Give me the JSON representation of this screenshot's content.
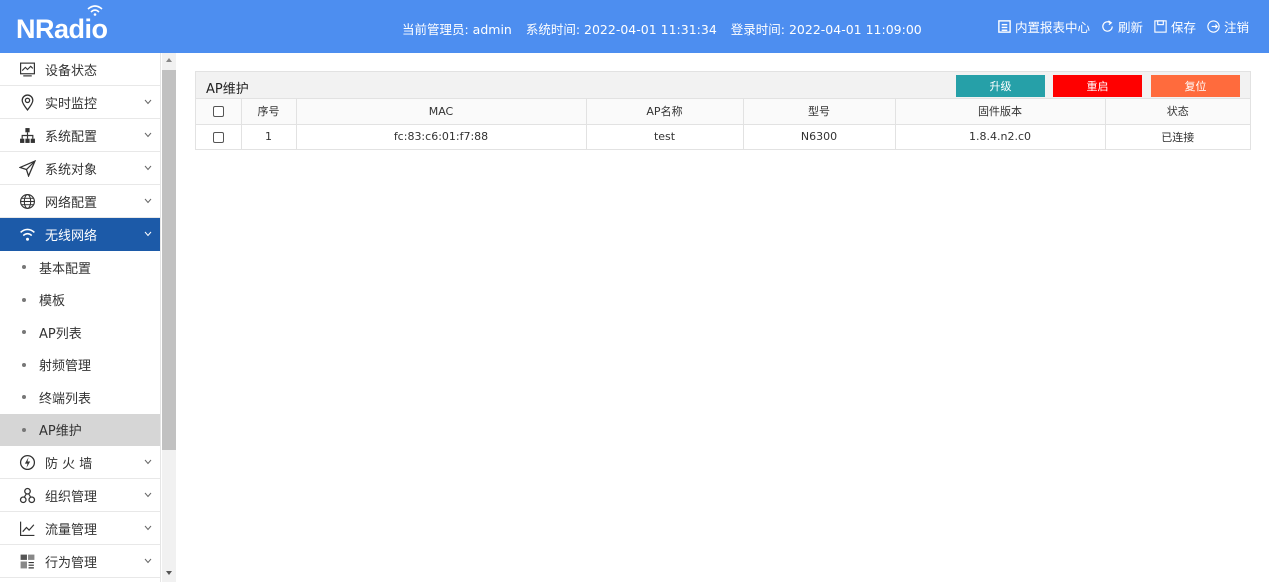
{
  "header": {
    "logo": "NRadio",
    "admin_label": "当前管理员: admin",
    "system_time": "系统时间: 2022-04-01 11:31:34",
    "login_time": "登录时间: 2022-04-01 11:09:00",
    "actions": {
      "report": "内置报表中心",
      "refresh": "刷新",
      "save": "保存",
      "logout": "注销"
    }
  },
  "sidebar": {
    "items": [
      {
        "label": "设备状态",
        "icon": "monitor-icon"
      },
      {
        "label": "实时监控",
        "icon": "location-pin-icon"
      },
      {
        "label": "系统配置",
        "icon": "sitemap-icon"
      },
      {
        "label": "系统对象",
        "icon": "send-icon"
      },
      {
        "label": "网络配置",
        "icon": "globe-icon"
      },
      {
        "label": "无线网络",
        "icon": "wifi-icon"
      },
      {
        "label": "防 火 墙",
        "icon": "firewall-icon"
      },
      {
        "label": "组织管理",
        "icon": "organization-icon"
      },
      {
        "label": "流量管理",
        "icon": "line-chart-icon"
      },
      {
        "label": "行为管理",
        "icon": "behavior-icon"
      }
    ],
    "sub_items": [
      "基本配置",
      "模板",
      "AP列表",
      "射频管理",
      "终端列表",
      "AP维护"
    ]
  },
  "panel": {
    "title": "AP维护",
    "buttons": {
      "upgrade": "升级",
      "reboot": "重启",
      "reset": "复位"
    },
    "button_colors": {
      "upgrade": "#26a0a8",
      "reboot": "#ff0000",
      "reset": "#ff6b3d"
    },
    "columns": [
      "序号",
      "MAC",
      "AP名称",
      "型号",
      "固件版本",
      "状态"
    ],
    "rows": [
      {
        "index": "1",
        "mac": "fc:83:c6:01:f7:88",
        "name": "test",
        "model": "N6300",
        "firmware": "1.8.4.n2.c0",
        "status": "已连接"
      }
    ]
  },
  "colors": {
    "header_bg": "#4d8ef0",
    "active_menu": "#1c5aa8",
    "selected_sub": "#d6d6d6"
  }
}
